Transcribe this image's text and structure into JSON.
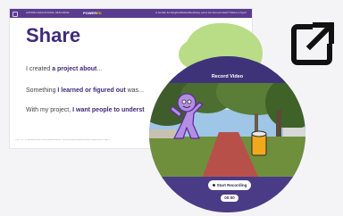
{
  "slide": {
    "header": {
      "org_name": "ARTSMIA EDUCATIONAL RESOURCE",
      "brand_power": "POWER",
      "brand_accent": "ED",
      "question": "Is Jennifer the Daughter/Mother/Beneficiary, and is she kind and what?? What is a Type?"
    },
    "title": "Share",
    "prompts": [
      {
        "text": "I created ",
        "bold": "a project about",
        "tail": "..."
      },
      {
        "text": "Something ",
        "bold": "I learned or figured out",
        "tail": " was..."
      },
      {
        "text": "With my project, ",
        "bold": "I want people to underst",
        "tail": ""
      }
    ],
    "footer_text": "© 2023 · P B S · For educational use only · Artsmia Educational Resource · Share your thoughts and projects with others · All rights reserved · Page 12"
  },
  "recorder": {
    "title": "Record Video",
    "record_label": "Start Recording",
    "timer": "00:00"
  },
  "icons": {
    "external_link": "external-link-icon",
    "record": "record-icon",
    "character": "character-icon",
    "drum": "drum-icon"
  },
  "colors": {
    "brand_purple": "#3f2a7a",
    "header_purple": "#5a3b8e",
    "blob_green": "#b9dc87",
    "recorder_purple": "#4a3b87"
  }
}
